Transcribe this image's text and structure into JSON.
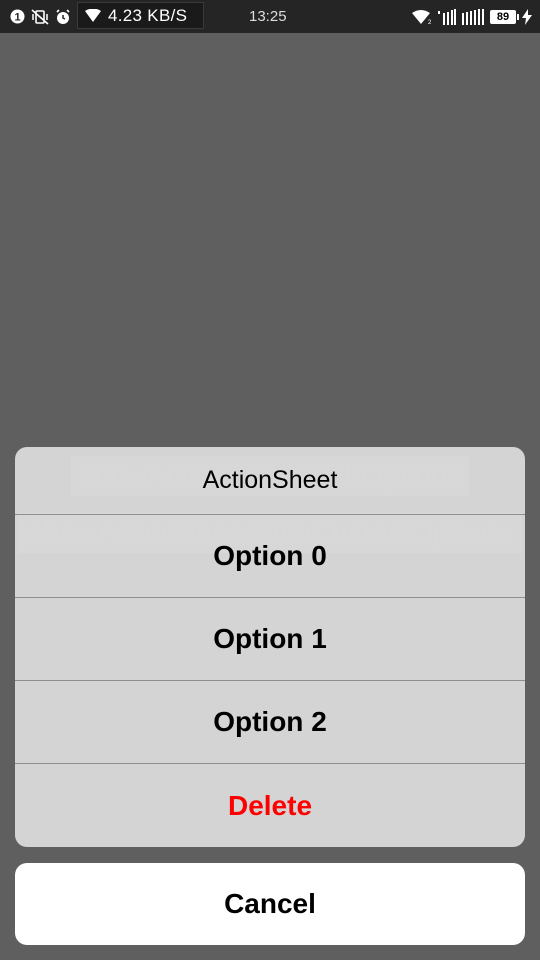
{
  "status_bar": {
    "network_speed": "4.23 KB/S",
    "time": "13:25",
    "battery": "89",
    "icons_left": [
      "notification-badge-icon",
      "vibrate-off-icon",
      "alarm-icon",
      "wifi-icon"
    ],
    "icons_right": [
      "wifi-icon",
      "signal-icon",
      "signal-icon",
      "battery-icon",
      "charging-icon"
    ]
  },
  "background": {
    "buttons": [
      {
        "label": "showActionSheetWithOptions"
      },
      {
        "label": "showActionSheetWithCustomOptions"
      }
    ]
  },
  "action_sheet": {
    "title": "ActionSheet",
    "options": [
      {
        "label": "Option 0"
      },
      {
        "label": "Option 1"
      },
      {
        "label": "Option 2"
      },
      {
        "label": "Delete",
        "destructive": true
      }
    ],
    "cancel_label": "Cancel",
    "destructive_color": "#ff0000"
  }
}
